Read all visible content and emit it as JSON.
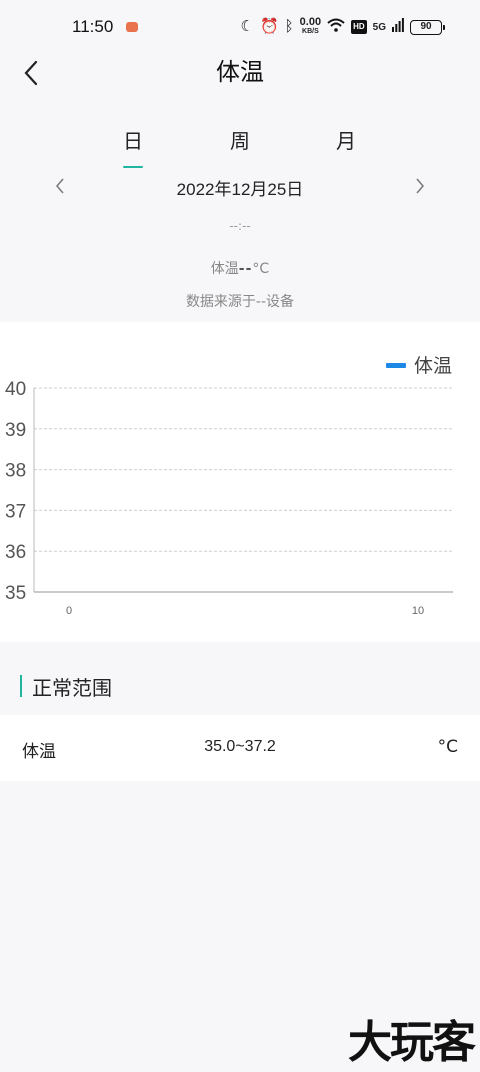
{
  "status_bar": {
    "time": "11:50",
    "net_speed_value": "0.00",
    "net_speed_unit": "KB/S",
    "hd_badge": "HD",
    "network": "5G",
    "battery": "90"
  },
  "header": {
    "title": "体温"
  },
  "tabs": [
    {
      "label": "日",
      "active": true
    },
    {
      "label": "周",
      "active": false
    },
    {
      "label": "月",
      "active": false
    }
  ],
  "date": "2022年12月25日",
  "time_value": "--:--",
  "reading": {
    "label": "体温",
    "value": "--",
    "unit": "°C"
  },
  "source": "数据来源于--设备",
  "chart_data": {
    "type": "line",
    "legend": [
      "体温"
    ],
    "legend_position": "top-right",
    "series": [
      {
        "name": "体温",
        "values": [],
        "color": "#1e88e5"
      }
    ],
    "x_ticks": [
      0,
      10
    ],
    "xlim": [
      0,
      10
    ],
    "y_ticks": [
      35,
      36,
      37,
      38,
      39,
      40
    ],
    "ylim": [
      35,
      40
    ],
    "grid": true
  },
  "normal_range": {
    "heading": "正常范围",
    "rows": [
      {
        "name": "体温",
        "range": "35.0~37.2",
        "unit": "°C"
      }
    ]
  },
  "watermark": "大玩客",
  "colors": {
    "accent": "#1fb5a0",
    "series": "#1e88e5",
    "background": "#f7f6f9"
  }
}
